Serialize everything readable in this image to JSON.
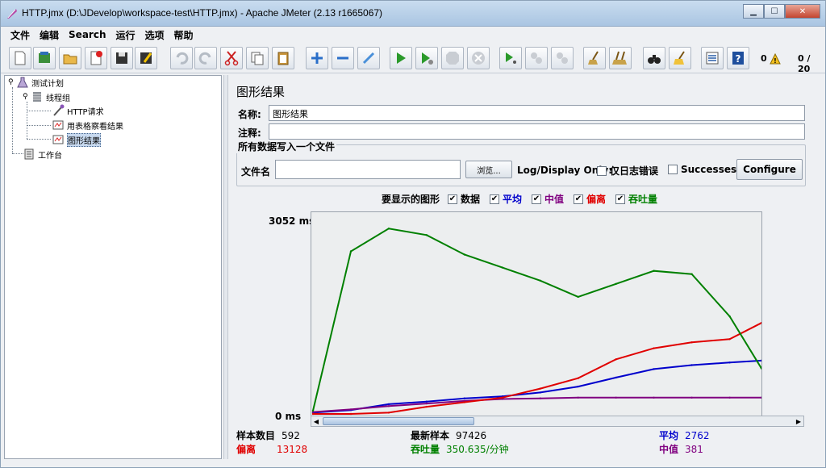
{
  "window": {
    "title": "HTTP.jmx (D:\\JDevelop\\workspace-test\\HTTP.jmx) - Apache JMeter (2.13 r1665067)"
  },
  "menu": [
    "文件",
    "编辑",
    "Search",
    "运行",
    "选项",
    "帮助"
  ],
  "toolbar": {
    "error_count": "0",
    "thread_count": "0 / 20"
  },
  "tree": {
    "plan": "测试计划",
    "group": "线程组",
    "http": "HTTP请求",
    "table": "用表格察看结果",
    "graph": "图形结果",
    "workbench": "工作台"
  },
  "panel": {
    "title": "图形结果",
    "name_label": "名称:",
    "name_value": "图形结果",
    "comment_label": "注释:",
    "comment_value": "",
    "file_group": "所有数据写入一个文件",
    "file_label": "文件名",
    "file_value": "",
    "browse_label": "浏览...",
    "log_only_label": "Log/Display Only:",
    "errors_label": "仅日志错误",
    "successes_label": "Successes",
    "configure_label": "Configure"
  },
  "graphs": {
    "label": "要显示的图形",
    "items": [
      {
        "label": "数据",
        "checked": true,
        "color": "#000000"
      },
      {
        "label": "平均",
        "checked": true,
        "color": "#0000cc"
      },
      {
        "label": "中值",
        "checked": true,
        "color": "#800080"
      },
      {
        "label": "偏离",
        "checked": true,
        "color": "#e00000"
      },
      {
        "label": "吞吐量",
        "checked": true,
        "color": "#008000"
      }
    ]
  },
  "chart_data": {
    "type": "line",
    "ylim": [
      0,
      3052
    ],
    "y_max_label": "3052 ms",
    "y_min_label": "0 ms",
    "x": [
      0,
      50,
      100,
      150,
      200,
      250,
      300,
      350,
      400,
      450,
      500,
      550,
      592
    ],
    "series": [
      {
        "name": "平均",
        "color": "#0000cc",
        "values": [
          20,
          60,
          150,
          190,
          240,
          270,
          330,
          420,
          560,
          690,
          750,
          790,
          820
        ]
      },
      {
        "name": "中值",
        "color": "#800080",
        "values": [
          30,
          70,
          120,
          160,
          200,
          230,
          240,
          250,
          250,
          250,
          250,
          250,
          250
        ]
      },
      {
        "name": "偏离",
        "color": "#e00000",
        "values": [
          -150,
          -50,
          20,
          110,
          180,
          250,
          390,
          550,
          840,
          1010,
          1100,
          1150,
          1400
        ]
      },
      {
        "name": "吞吐量",
        "color": "#008000",
        "values": [
          50,
          2500,
          2850,
          2750,
          2450,
          2250,
          2050,
          1800,
          2000,
          2200,
          2150,
          1500,
          700
        ]
      }
    ]
  },
  "stats": {
    "samples_label": "样本数目",
    "samples": "592",
    "latest_label": "最新样本",
    "latest": "97426",
    "average_label": "平均",
    "average": "2762",
    "deviation_label": "偏离",
    "deviation": "13128",
    "throughput_label": "吞吐量",
    "throughput": "350.635/分钟",
    "median_label": "中值",
    "median": "381"
  }
}
